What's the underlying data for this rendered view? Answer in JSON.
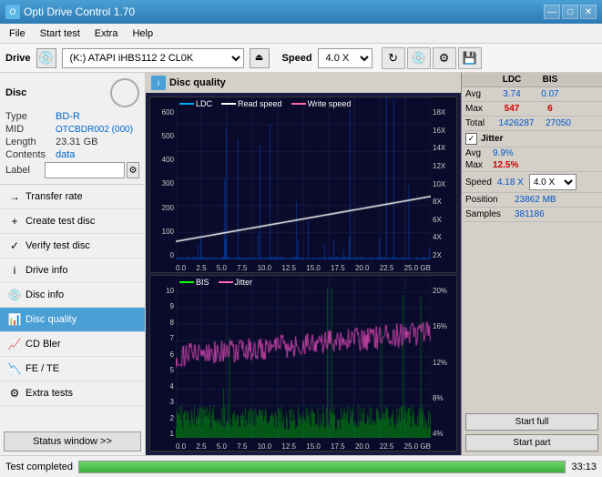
{
  "titlebar": {
    "title": "Opti Drive Control 1.70",
    "icon": "O",
    "controls": [
      "—",
      "□",
      "✕"
    ]
  },
  "menubar": {
    "items": [
      "File",
      "Start test",
      "Extra",
      "Help"
    ]
  },
  "drivebar": {
    "label": "Drive",
    "drive_value": "(K:) ATAPI iHBS112  2 CL0K",
    "speed_label": "Speed",
    "speed_value": "4.0 X"
  },
  "sidebar": {
    "disc_title": "Disc",
    "fields": [
      {
        "label": "Type",
        "value": "BD-R",
        "color": "blue"
      },
      {
        "label": "MID",
        "value": "OTCBDR002 (000)",
        "color": "blue"
      },
      {
        "label": "Length",
        "value": "23.31 GB",
        "color": "normal"
      },
      {
        "label": "Contents",
        "value": "data",
        "color": "blue"
      },
      {
        "label": "Label",
        "value": "",
        "color": "normal"
      }
    ],
    "nav_items": [
      {
        "label": "Transfer rate",
        "icon": "→",
        "active": false
      },
      {
        "label": "Create test disc",
        "icon": "+",
        "active": false
      },
      {
        "label": "Verify test disc",
        "icon": "✓",
        "active": false
      },
      {
        "label": "Drive info",
        "icon": "i",
        "active": false
      },
      {
        "label": "Disc info",
        "icon": "💿",
        "active": false
      },
      {
        "label": "Disc quality",
        "icon": "📊",
        "active": true
      },
      {
        "label": "CD Bler",
        "icon": "📈",
        "active": false
      },
      {
        "label": "FE / TE",
        "icon": "📉",
        "active": false
      },
      {
        "label": "Extra tests",
        "icon": "⚙",
        "active": false
      }
    ],
    "status_btn": "Status window >>"
  },
  "disc_quality": {
    "title": "Disc quality",
    "legend": [
      {
        "label": "LDC",
        "color": "#00aaff"
      },
      {
        "label": "Read speed",
        "color": "#ffffff"
      },
      {
        "label": "Write speed",
        "color": "#ff69b4"
      }
    ],
    "legend2": [
      {
        "label": "BIS",
        "color": "#00ff00"
      },
      {
        "label": "Jitter",
        "color": "#ff69b4"
      }
    ],
    "chart1": {
      "y_max": 600,
      "y_labels_left": [
        "600",
        "500",
        "400",
        "300",
        "200",
        "100",
        "0"
      ],
      "y_labels_right": [
        "18X",
        "16X",
        "14X",
        "12X",
        "10X",
        "8X",
        "6X",
        "4X",
        "2X"
      ],
      "x_labels": [
        "0.0",
        "2.5",
        "5.0",
        "7.5",
        "10.0",
        "12.5",
        "15.0",
        "17.5",
        "20.0",
        "22.5",
        "25.0"
      ]
    },
    "chart2": {
      "y_labels_left": [
        "10",
        "9",
        "8",
        "7",
        "6",
        "5",
        "4",
        "3",
        "2",
        "1"
      ],
      "y_labels_right": [
        "20%",
        "16%",
        "12%",
        "8%",
        "4%"
      ],
      "x_labels": [
        "0.0",
        "2.5",
        "5.0",
        "7.5",
        "10.0",
        "12.5",
        "15.0",
        "17.5",
        "20.0",
        "22.5",
        "25.0"
      ]
    }
  },
  "stats": {
    "headers": [
      "LDC",
      "BIS",
      "",
      "Jitter",
      "Speed"
    ],
    "avg_label": "Avg",
    "avg_ldc": "3.74",
    "avg_bis": "0.07",
    "avg_jitter": "9.9%",
    "max_label": "Max",
    "max_ldc": "547",
    "max_bis": "6",
    "max_jitter": "12.5%",
    "total_label": "Total",
    "total_ldc": "1426287",
    "total_bis": "27050",
    "speed_label": "Speed",
    "speed_value": "4.18 X",
    "speed_select": "4.0 X",
    "position_label": "Position",
    "position_value": "23862 MB",
    "samples_label": "Samples",
    "samples_value": "381186",
    "start_full": "Start full",
    "start_part": "Start part"
  },
  "statusbar": {
    "text": "Test completed",
    "progress": 100,
    "time": "33:13"
  }
}
